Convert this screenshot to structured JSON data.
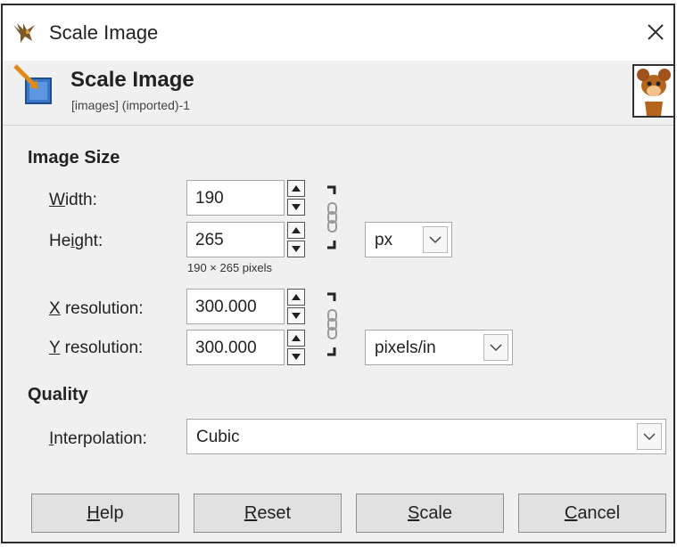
{
  "window": {
    "title": "Scale Image",
    "icons": {
      "app": "gimp-icon",
      "close": "close-icon"
    }
  },
  "header": {
    "title": "Scale Image",
    "subtitle": "[images] (imported)-1",
    "icons": {
      "scale": "scale-image-icon",
      "thumbnail": "image-thumbnail-icon"
    }
  },
  "image_size": {
    "section_title": "Image Size",
    "width": {
      "label_accel": "W",
      "label_rest": "idth:",
      "value": "190"
    },
    "height": {
      "label_pre": "He",
      "label_accel": "i",
      "label_rest": "ght:",
      "value": "265"
    },
    "pixel_info": "190 × 265 pixels",
    "unit": "px",
    "x_resolution": {
      "label_accel": "X",
      "label_rest": " resolution:",
      "value": "300.000"
    },
    "y_resolution": {
      "label_accel": "Y",
      "label_rest": " resolution:",
      "value": "300.000"
    },
    "resolution_unit": "pixels/in"
  },
  "quality": {
    "section_title": "Quality",
    "interpolation": {
      "label_accel": "I",
      "label_rest": "nterpolation:",
      "value": "Cubic"
    }
  },
  "buttons": {
    "help": {
      "accel": "H",
      "rest": "elp"
    },
    "reset": {
      "accel": "R",
      "rest": "eset"
    },
    "scale": {
      "accel": "S",
      "rest": "cale"
    },
    "cancel": {
      "accel": "C",
      "rest": "ancel"
    }
  },
  "colors": {
    "dialog_bg": "#f0f0f0",
    "title_bg": "#ffffff",
    "button_bg": "#e1e1e1"
  }
}
